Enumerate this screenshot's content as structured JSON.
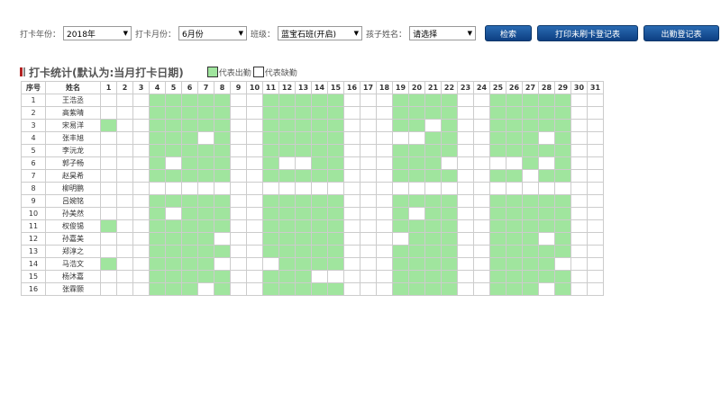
{
  "filters": {
    "year_label": "打卡年份：",
    "year_value": "2018年",
    "month_label": "打卡月份：",
    "month_value": "6月份",
    "class_label": "班级：",
    "class_value": "蓝宝石班(开启)",
    "child_label": "孩子姓名：",
    "child_value": "请选择"
  },
  "buttons": {
    "search": "检索",
    "print_unswiped": "打印未刷卡登记表",
    "attendance_register": "出勤登记表"
  },
  "section": {
    "title": "打卡统计(默认为:当月打卡日期)",
    "legend_present": "代表出勤",
    "legend_absent": "代表缺勤"
  },
  "colors": {
    "present": "#a0e59e",
    "absent": "#ffffff",
    "button": "#1a5296"
  },
  "table": {
    "seq_header": "序号",
    "name_header": "姓名",
    "days": [
      "1",
      "2",
      "3",
      "4",
      "5",
      "6",
      "7",
      "8",
      "9",
      "10",
      "11",
      "12",
      "13",
      "14",
      "15",
      "16",
      "17",
      "18",
      "19",
      "20",
      "21",
      "22",
      "23",
      "24",
      "25",
      "26",
      "27",
      "28",
      "29",
      "30",
      "31"
    ],
    "rows": [
      {
        "seq": "1",
        "name": "王浩丞",
        "attendance": "0001111100111110001111001111100"
      },
      {
        "seq": "2",
        "name": "高紫晴",
        "attendance": "0001111100111110001111001111100"
      },
      {
        "seq": "3",
        "name": "宋易洋",
        "attendance": "1001111100111110001101001111100"
      },
      {
        "seq": "4",
        "name": "张丰旭",
        "attendance": "0001110100111110000011001110100"
      },
      {
        "seq": "5",
        "name": "李沅龙",
        "attendance": "0001111100111110001111001111100"
      },
      {
        "seq": "6",
        "name": "郭子畅",
        "attendance": "0001011100100110001110000010100"
      },
      {
        "seq": "7",
        "name": "赵昊希",
        "attendance": "0001111100111110001111001101100"
      },
      {
        "seq": "8",
        "name": "柳明鹏",
        "attendance": "0000000000000000000000000000000"
      },
      {
        "seq": "9",
        "name": "吕婉铭",
        "attendance": "0001111100111110001111001111100"
      },
      {
        "seq": "10",
        "name": "孙美然",
        "attendance": "0001011100111110001011001111100"
      },
      {
        "seq": "11",
        "name": "权俊锡",
        "attendance": "1001111100111110001111001111100"
      },
      {
        "seq": "12",
        "name": "孙嘉美",
        "attendance": "0001111000111110000111001110100"
      },
      {
        "seq": "13",
        "name": "郑淳之",
        "attendance": "0001111100111110001111001111100"
      },
      {
        "seq": "14",
        "name": "马浩文",
        "attendance": "1001111000011110001111001111000"
      },
      {
        "seq": "15",
        "name": "杨沐嘉",
        "attendance": "0001111100111000001111001111100"
      },
      {
        "seq": "16",
        "name": "张霖颢",
        "attendance": "0001110100111110001111001110100"
      }
    ]
  }
}
